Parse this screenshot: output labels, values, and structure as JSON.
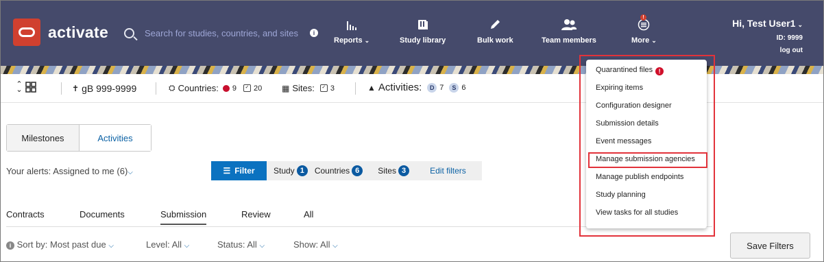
{
  "header": {
    "app_name": "activate",
    "search_placeholder": "Search for studies, countries, and sites",
    "nav": [
      {
        "label": "Reports",
        "icon": "bar-chart-icon",
        "has_caret": true
      },
      {
        "label": "Study library",
        "icon": "book-icon",
        "has_caret": false
      },
      {
        "label": "Bulk work",
        "icon": "pencil-icon",
        "has_caret": false
      },
      {
        "label": "Team members",
        "icon": "users-icon",
        "has_caret": false
      },
      {
        "label": "More",
        "icon": "menu-alert-icon",
        "has_caret": true
      }
    ],
    "user": {
      "greeting": "Hi, Test User1",
      "id": "ID: 9999",
      "logout": "log out"
    },
    "more_badge": "!"
  },
  "studybar": {
    "study_code": "gB 999-9999",
    "countries_label": "Countries:",
    "countries_red": "9",
    "countries_done": "20",
    "sites_label": "Sites:",
    "sites_done": "3",
    "activities_label": "Activities:",
    "activities_d_badge": "D",
    "activities_d": "7",
    "activities_s_badge": "S",
    "activities_s": "6"
  },
  "view_tabs": [
    "Milestones",
    "Activities"
  ],
  "alerts": {
    "label": "Your alerts:",
    "value": "Assigned to me (6)"
  },
  "filterbar": {
    "filter_label": "Filter",
    "chips": [
      {
        "label": "Study",
        "count": "1"
      },
      {
        "label": "Countries",
        "count": "6"
      },
      {
        "label": "Sites",
        "count": "3"
      }
    ],
    "edit_label": "Edit filters"
  },
  "subtabs": [
    "Contracts",
    "Documents",
    "Submission",
    "Review",
    "All"
  ],
  "sort": {
    "sort_by": "Sort by: Most past due",
    "level": "Level: All",
    "status": "Status: All",
    "show": "Show: All"
  },
  "save_filters_label": "Save Filters",
  "more_menu": {
    "items": [
      {
        "label": "Quarantined files",
        "alert": "!"
      },
      {
        "label": "Expiring items"
      },
      {
        "label": "Configuration designer"
      },
      {
        "label": "Submission details"
      },
      {
        "label": "Event messages"
      },
      {
        "label": "Manage submission agencies"
      },
      {
        "label": "Manage publish endpoints"
      },
      {
        "label": "Study planning"
      },
      {
        "label": "View tasks for all studies"
      }
    ]
  },
  "colors": {
    "header_bg": "#454a6b",
    "accent": "#0b72c0",
    "highlight": "#e2323a",
    "alert_red": "#d0102a"
  }
}
